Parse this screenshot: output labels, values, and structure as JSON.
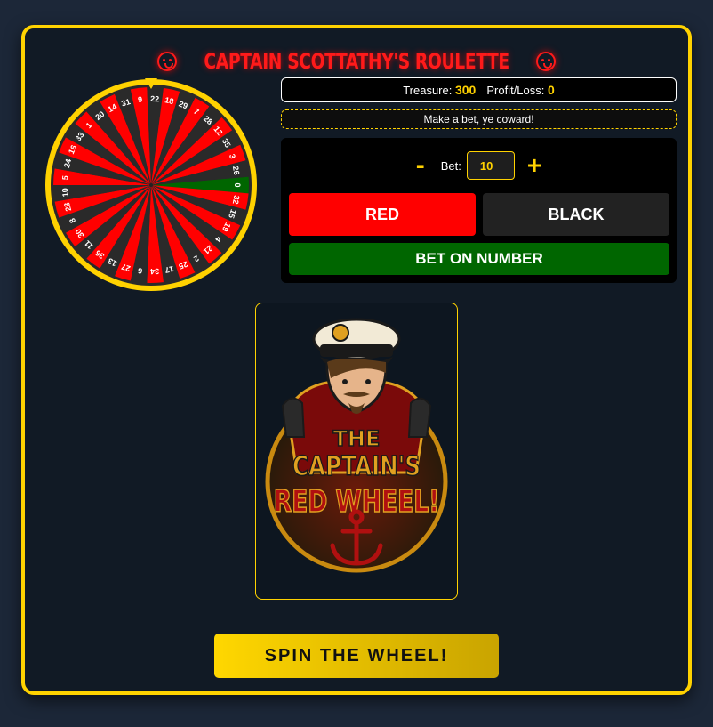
{
  "title": "CAPTAIN SCOTTATHY'S ROULETTE",
  "stats": {
    "treasure_label": "Treasure:",
    "treasure_value": "300",
    "profit_label": "Profit/Loss:",
    "profit_value": "0"
  },
  "message": "Make a bet, ye coward!",
  "bet": {
    "minus_label": "-",
    "label": "Bet:",
    "value": "10",
    "plus_label": "+"
  },
  "buttons": {
    "red": "RED",
    "black": "BLACK",
    "number": "BET ON NUMBER",
    "spin": "SPIN THE WHEEL!"
  },
  "wheel": {
    "numbers": [
      "0",
      "32",
      "15",
      "19",
      "4",
      "21",
      "2",
      "25",
      "17",
      "34",
      "6",
      "27",
      "13",
      "36",
      "11",
      "30",
      "8",
      "23",
      "10",
      "5",
      "24",
      "16",
      "33",
      "1",
      "20",
      "14",
      "31",
      "9",
      "22",
      "18",
      "29",
      "7",
      "28",
      "12",
      "35",
      "3",
      "26"
    ],
    "colors": {
      "red": "#ff0000",
      "black": "#2a2a2a",
      "green": "#006600",
      "rim": "#ffd200"
    }
  },
  "logo": {
    "line1": "THE",
    "line2": "CAPTAIN'S",
    "line3": "RED WHEEL!"
  },
  "colors": {
    "accent": "#ffd200",
    "title": "#ff1a1a",
    "background": "#111a25"
  }
}
